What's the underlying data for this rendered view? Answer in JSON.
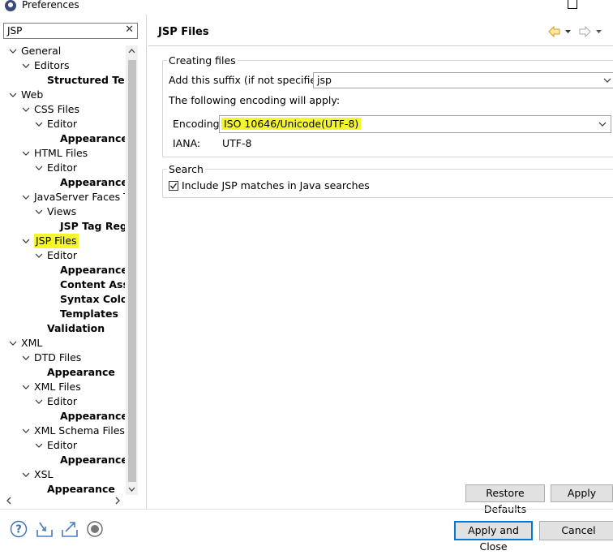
{
  "window": {
    "title": "Preferences"
  },
  "filter": {
    "value": "JSP",
    "clear_label": "✕"
  },
  "tree": [
    {
      "label": "General",
      "indent": 0,
      "chevron": "down",
      "bold": false
    },
    {
      "label": "Editors",
      "indent": 1,
      "chevron": "down",
      "bold": false
    },
    {
      "label": "Structured Text",
      "indent": 2,
      "chevron": "none",
      "bold": true
    },
    {
      "label": "Web",
      "indent": 0,
      "chevron": "down",
      "bold": false
    },
    {
      "label": "CSS Files",
      "indent": 1,
      "chevron": "down",
      "bold": false
    },
    {
      "label": "Editor",
      "indent": 2,
      "chevron": "down",
      "bold": false
    },
    {
      "label": "Appearance",
      "indent": 3,
      "chevron": "none",
      "bold": true
    },
    {
      "label": "HTML Files",
      "indent": 1,
      "chevron": "down",
      "bold": false
    },
    {
      "label": "Editor",
      "indent": 2,
      "chevron": "down",
      "bold": false
    },
    {
      "label": "Appearance",
      "indent": 3,
      "chevron": "none",
      "bold": true
    },
    {
      "label": "JavaServer Faces Too",
      "indent": 1,
      "chevron": "down",
      "bold": false
    },
    {
      "label": "Views",
      "indent": 2,
      "chevron": "down",
      "bold": false
    },
    {
      "label": "JSP Tag Regis",
      "indent": 3,
      "chevron": "none",
      "bold": true
    },
    {
      "label": "JSP Files",
      "indent": 1,
      "chevron": "down",
      "bold": false,
      "selected": true
    },
    {
      "label": "Editor",
      "indent": 2,
      "chevron": "down",
      "bold": false
    },
    {
      "label": "Appearance",
      "indent": 3,
      "chevron": "none",
      "bold": true
    },
    {
      "label": "Content Assis",
      "indent": 3,
      "chevron": "none",
      "bold": true
    },
    {
      "label": "Syntax Colorir",
      "indent": 3,
      "chevron": "none",
      "bold": true
    },
    {
      "label": "Templates",
      "indent": 3,
      "chevron": "none",
      "bold": true
    },
    {
      "label": "Validation",
      "indent": 2,
      "chevron": "none",
      "bold": true
    },
    {
      "label": "XML",
      "indent": 0,
      "chevron": "down",
      "bold": false
    },
    {
      "label": "DTD Files",
      "indent": 1,
      "chevron": "down",
      "bold": false
    },
    {
      "label": "Appearance",
      "indent": 2,
      "chevron": "none",
      "bold": true
    },
    {
      "label": "XML Files",
      "indent": 1,
      "chevron": "down",
      "bold": false
    },
    {
      "label": "Editor",
      "indent": 2,
      "chevron": "down",
      "bold": false
    },
    {
      "label": "Appearance",
      "indent": 3,
      "chevron": "none",
      "bold": true
    },
    {
      "label": "XML Schema Files",
      "indent": 1,
      "chevron": "down",
      "bold": false
    },
    {
      "label": "Editor",
      "indent": 2,
      "chevron": "down",
      "bold": false
    },
    {
      "label": "Appearance",
      "indent": 3,
      "chevron": "none",
      "bold": true
    },
    {
      "label": "XSL",
      "indent": 1,
      "chevron": "down",
      "bold": false
    },
    {
      "label": "Appearance",
      "indent": 2,
      "chevron": "none",
      "bold": true
    }
  ],
  "page": {
    "title": "JSP Files",
    "creating_files": {
      "group_label": "Creating files",
      "suffix_label": "Add this suffix (if not specified):",
      "suffix_value": "jsp",
      "encoding_intro": "The following encoding will apply:",
      "encoding_label": "Encoding:",
      "encoding_value": "ISO 10646/Unicode(UTF-8)",
      "iana_label": "IANA:",
      "iana_value": "UTF-8"
    },
    "search": {
      "group_label": "Search",
      "include_label": "Include JSP matches in Java searches",
      "include_checked": true
    }
  },
  "buttons": {
    "restore_defaults": "Restore Defaults",
    "apply": "Apply",
    "apply_and_close": "Apply and Close",
    "cancel": "Cancel"
  },
  "colors": {
    "highlight": "#f4f82a",
    "default_button_border": "#0078d7"
  }
}
